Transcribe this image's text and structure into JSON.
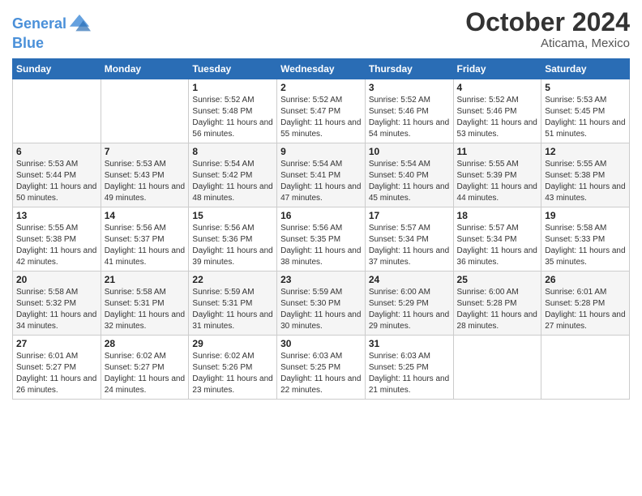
{
  "header": {
    "logo_line1": "General",
    "logo_line2": "Blue",
    "month_title": "October 2024",
    "location": "Aticama, Mexico"
  },
  "weekdays": [
    "Sunday",
    "Monday",
    "Tuesday",
    "Wednesday",
    "Thursday",
    "Friday",
    "Saturday"
  ],
  "weeks": [
    [
      {
        "day": "",
        "sunrise": "",
        "sunset": "",
        "daylight": ""
      },
      {
        "day": "",
        "sunrise": "",
        "sunset": "",
        "daylight": ""
      },
      {
        "day": "1",
        "sunrise": "Sunrise: 5:52 AM",
        "sunset": "Sunset: 5:48 PM",
        "daylight": "Daylight: 11 hours and 56 minutes."
      },
      {
        "day": "2",
        "sunrise": "Sunrise: 5:52 AM",
        "sunset": "Sunset: 5:47 PM",
        "daylight": "Daylight: 11 hours and 55 minutes."
      },
      {
        "day": "3",
        "sunrise": "Sunrise: 5:52 AM",
        "sunset": "Sunset: 5:46 PM",
        "daylight": "Daylight: 11 hours and 54 minutes."
      },
      {
        "day": "4",
        "sunrise": "Sunrise: 5:52 AM",
        "sunset": "Sunset: 5:46 PM",
        "daylight": "Daylight: 11 hours and 53 minutes."
      },
      {
        "day": "5",
        "sunrise": "Sunrise: 5:53 AM",
        "sunset": "Sunset: 5:45 PM",
        "daylight": "Daylight: 11 hours and 51 minutes."
      }
    ],
    [
      {
        "day": "6",
        "sunrise": "Sunrise: 5:53 AM",
        "sunset": "Sunset: 5:44 PM",
        "daylight": "Daylight: 11 hours and 50 minutes."
      },
      {
        "day": "7",
        "sunrise": "Sunrise: 5:53 AM",
        "sunset": "Sunset: 5:43 PM",
        "daylight": "Daylight: 11 hours and 49 minutes."
      },
      {
        "day": "8",
        "sunrise": "Sunrise: 5:54 AM",
        "sunset": "Sunset: 5:42 PM",
        "daylight": "Daylight: 11 hours and 48 minutes."
      },
      {
        "day": "9",
        "sunrise": "Sunrise: 5:54 AM",
        "sunset": "Sunset: 5:41 PM",
        "daylight": "Daylight: 11 hours and 47 minutes."
      },
      {
        "day": "10",
        "sunrise": "Sunrise: 5:54 AM",
        "sunset": "Sunset: 5:40 PM",
        "daylight": "Daylight: 11 hours and 45 minutes."
      },
      {
        "day": "11",
        "sunrise": "Sunrise: 5:55 AM",
        "sunset": "Sunset: 5:39 PM",
        "daylight": "Daylight: 11 hours and 44 minutes."
      },
      {
        "day": "12",
        "sunrise": "Sunrise: 5:55 AM",
        "sunset": "Sunset: 5:38 PM",
        "daylight": "Daylight: 11 hours and 43 minutes."
      }
    ],
    [
      {
        "day": "13",
        "sunrise": "Sunrise: 5:55 AM",
        "sunset": "Sunset: 5:38 PM",
        "daylight": "Daylight: 11 hours and 42 minutes."
      },
      {
        "day": "14",
        "sunrise": "Sunrise: 5:56 AM",
        "sunset": "Sunset: 5:37 PM",
        "daylight": "Daylight: 11 hours and 41 minutes."
      },
      {
        "day": "15",
        "sunrise": "Sunrise: 5:56 AM",
        "sunset": "Sunset: 5:36 PM",
        "daylight": "Daylight: 11 hours and 39 minutes."
      },
      {
        "day": "16",
        "sunrise": "Sunrise: 5:56 AM",
        "sunset": "Sunset: 5:35 PM",
        "daylight": "Daylight: 11 hours and 38 minutes."
      },
      {
        "day": "17",
        "sunrise": "Sunrise: 5:57 AM",
        "sunset": "Sunset: 5:34 PM",
        "daylight": "Daylight: 11 hours and 37 minutes."
      },
      {
        "day": "18",
        "sunrise": "Sunrise: 5:57 AM",
        "sunset": "Sunset: 5:34 PM",
        "daylight": "Daylight: 11 hours and 36 minutes."
      },
      {
        "day": "19",
        "sunrise": "Sunrise: 5:58 AM",
        "sunset": "Sunset: 5:33 PM",
        "daylight": "Daylight: 11 hours and 35 minutes."
      }
    ],
    [
      {
        "day": "20",
        "sunrise": "Sunrise: 5:58 AM",
        "sunset": "Sunset: 5:32 PM",
        "daylight": "Daylight: 11 hours and 34 minutes."
      },
      {
        "day": "21",
        "sunrise": "Sunrise: 5:58 AM",
        "sunset": "Sunset: 5:31 PM",
        "daylight": "Daylight: 11 hours and 32 minutes."
      },
      {
        "day": "22",
        "sunrise": "Sunrise: 5:59 AM",
        "sunset": "Sunset: 5:31 PM",
        "daylight": "Daylight: 11 hours and 31 minutes."
      },
      {
        "day": "23",
        "sunrise": "Sunrise: 5:59 AM",
        "sunset": "Sunset: 5:30 PM",
        "daylight": "Daylight: 11 hours and 30 minutes."
      },
      {
        "day": "24",
        "sunrise": "Sunrise: 6:00 AM",
        "sunset": "Sunset: 5:29 PM",
        "daylight": "Daylight: 11 hours and 29 minutes."
      },
      {
        "day": "25",
        "sunrise": "Sunrise: 6:00 AM",
        "sunset": "Sunset: 5:28 PM",
        "daylight": "Daylight: 11 hours and 28 minutes."
      },
      {
        "day": "26",
        "sunrise": "Sunrise: 6:01 AM",
        "sunset": "Sunset: 5:28 PM",
        "daylight": "Daylight: 11 hours and 27 minutes."
      }
    ],
    [
      {
        "day": "27",
        "sunrise": "Sunrise: 6:01 AM",
        "sunset": "Sunset: 5:27 PM",
        "daylight": "Daylight: 11 hours and 26 minutes."
      },
      {
        "day": "28",
        "sunrise": "Sunrise: 6:02 AM",
        "sunset": "Sunset: 5:27 PM",
        "daylight": "Daylight: 11 hours and 24 minutes."
      },
      {
        "day": "29",
        "sunrise": "Sunrise: 6:02 AM",
        "sunset": "Sunset: 5:26 PM",
        "daylight": "Daylight: 11 hours and 23 minutes."
      },
      {
        "day": "30",
        "sunrise": "Sunrise: 6:03 AM",
        "sunset": "Sunset: 5:25 PM",
        "daylight": "Daylight: 11 hours and 22 minutes."
      },
      {
        "day": "31",
        "sunrise": "Sunrise: 6:03 AM",
        "sunset": "Sunset: 5:25 PM",
        "daylight": "Daylight: 11 hours and 21 minutes."
      },
      {
        "day": "",
        "sunrise": "",
        "sunset": "",
        "daylight": ""
      },
      {
        "day": "",
        "sunrise": "",
        "sunset": "",
        "daylight": ""
      }
    ]
  ]
}
